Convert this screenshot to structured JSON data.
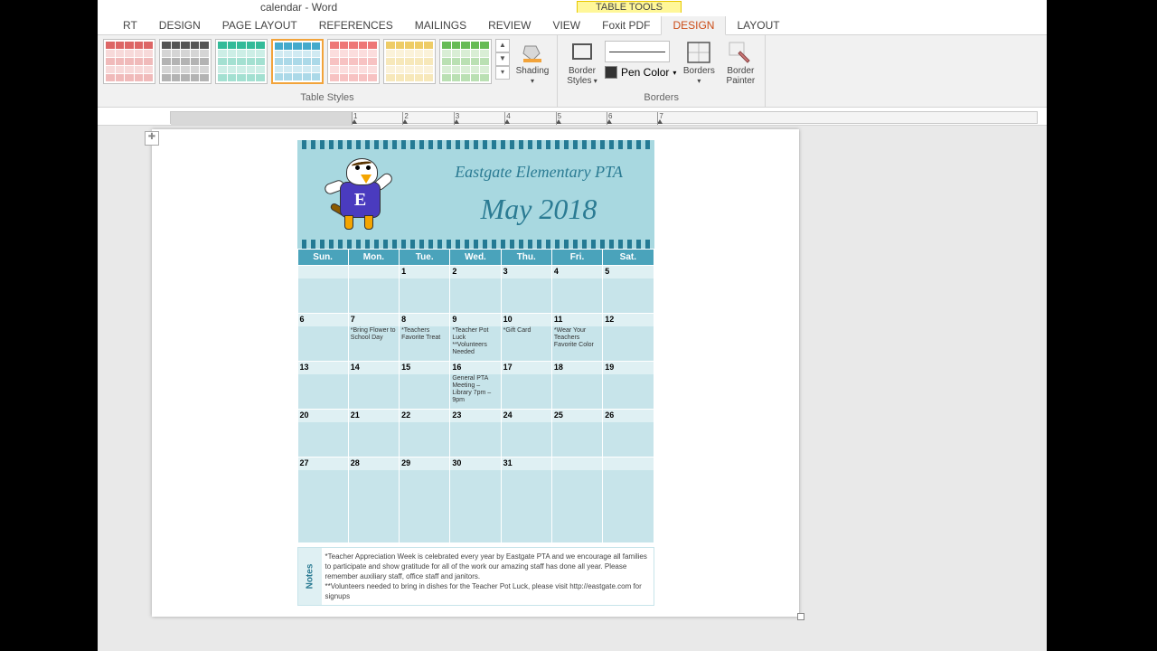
{
  "window": {
    "title": "calendar - Word",
    "table_tools": "TABLE TOOLS"
  },
  "tabs": {
    "insert_frag": "RT",
    "design": "DESIGN",
    "page_layout": "PAGE LAYOUT",
    "references": "REFERENCES",
    "mailings": "MAILINGS",
    "review": "REVIEW",
    "view": "VIEW",
    "foxit": "Foxit PDF",
    "tt_design": "DESIGN",
    "tt_layout": "LAYOUT"
  },
  "ribbon": {
    "group_styles": "Table Styles",
    "group_borders": "Borders",
    "shading": "Shading",
    "border_styles": "Border Styles",
    "pen_color": "Pen Color",
    "borders": "Borders",
    "border_painter": "Border Painter",
    "style_colors": [
      "#d66",
      "#555",
      "#3b9",
      "#4ac",
      "#e77",
      "#ec6",
      "#6b5"
    ],
    "selected_style_index": 3
  },
  "ruler": {
    "marks": [
      "1",
      "2",
      "3",
      "4",
      "5",
      "6",
      "7"
    ]
  },
  "calendar": {
    "org": "Eastgate Elementary PTA",
    "month": "May 2018",
    "day_headers": [
      "Sun.",
      "Mon.",
      "Tue.",
      "Wed.",
      "Thu.",
      "Fri.",
      "Sat."
    ],
    "weeks": [
      [
        {
          "n": "",
          "t": ""
        },
        {
          "n": "",
          "t": ""
        },
        {
          "n": "1",
          "t": ""
        },
        {
          "n": "2",
          "t": ""
        },
        {
          "n": "3",
          "t": ""
        },
        {
          "n": "4",
          "t": ""
        },
        {
          "n": "5",
          "t": ""
        }
      ],
      [
        {
          "n": "6",
          "t": ""
        },
        {
          "n": "7",
          "t": "*Bring Flower to School Day"
        },
        {
          "n": "8",
          "t": "*Teachers Favorite Treat"
        },
        {
          "n": "9",
          "t": "*Teacher Pot Luck\n**Volunteers Needed"
        },
        {
          "n": "10",
          "t": "*Gift Card"
        },
        {
          "n": "11",
          "t": "*Wear Your Teachers Favorite Color"
        },
        {
          "n": "12",
          "t": ""
        }
      ],
      [
        {
          "n": "13",
          "t": ""
        },
        {
          "n": "14",
          "t": ""
        },
        {
          "n": "15",
          "t": ""
        },
        {
          "n": "16",
          "t": "General PTA Meeting – Library 7pm – 9pm"
        },
        {
          "n": "17",
          "t": ""
        },
        {
          "n": "18",
          "t": ""
        },
        {
          "n": "19",
          "t": ""
        }
      ],
      [
        {
          "n": "20",
          "t": ""
        },
        {
          "n": "21",
          "t": ""
        },
        {
          "n": "22",
          "t": ""
        },
        {
          "n": "23",
          "t": ""
        },
        {
          "n": "24",
          "t": ""
        },
        {
          "n": "25",
          "t": ""
        },
        {
          "n": "26",
          "t": ""
        }
      ],
      [
        {
          "n": "27",
          "t": ""
        },
        {
          "n": "28",
          "t": ""
        },
        {
          "n": "29",
          "t": ""
        },
        {
          "n": "30",
          "t": ""
        },
        {
          "n": "31",
          "t": ""
        },
        {
          "n": "",
          "t": ""
        },
        {
          "n": "",
          "t": ""
        }
      ]
    ],
    "notes_label": "Notes",
    "notes_line1": "*Teacher Appreciation Week is celebrated every year by Eastgate PTA and we encourage all families to participate and show gratitude for all of the work our amazing staff has done all year.  Please remember auxiliary staff, office staff and janitors.",
    "notes_line2": "**Volunteers needed to bring in dishes for the Teacher Pot Luck, please visit http://eastgate.com for signups"
  }
}
